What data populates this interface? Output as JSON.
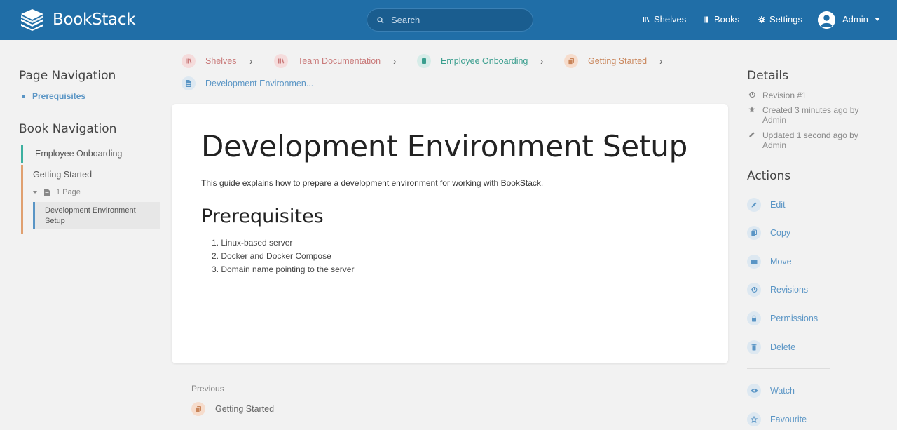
{
  "header": {
    "app_name": "BookStack",
    "search_placeholder": "Search",
    "nav": {
      "shelves": "Shelves",
      "books": "Books",
      "settings": "Settings"
    },
    "user": "Admin"
  },
  "breadcrumbs": [
    {
      "label": "Shelves",
      "color": "#c97a7a"
    },
    {
      "label": "Team Documentation",
      "color": "#c97a7a"
    },
    {
      "label": "Employee Onboarding",
      "color": "#3a9e8e"
    },
    {
      "label": "Getting Started",
      "color": "#c9855a"
    },
    {
      "label": "Development Environmen...",
      "color": "#5a95c5"
    }
  ],
  "page_nav": {
    "heading": "Page Navigation",
    "items": [
      "Prerequisites"
    ]
  },
  "book_nav": {
    "heading": "Book Navigation",
    "book": "Employee Onboarding",
    "chapter": "Getting Started",
    "pages_count": "1 Page",
    "current_page_line1": "Development Environment",
    "current_page_line2": "Setup"
  },
  "page": {
    "title": "Development Environment Setup",
    "intro": "This guide explains how to prepare a development environment for working with BookStack.",
    "section_heading": "Prerequisites",
    "list": [
      "1. Linux-based server",
      "2. Docker and Docker Compose",
      "3. Domain name pointing to the server"
    ]
  },
  "previous": {
    "label": "Previous",
    "link": "Getting Started"
  },
  "details": {
    "heading": "Details",
    "revision": "Revision #1",
    "created_line1": "Created 3 minutes ago by",
    "created_line2": "Admin",
    "updated_line1": "Updated 1 second ago by",
    "updated_line2": "Admin"
  },
  "actions": {
    "heading": "Actions",
    "edit": "Edit",
    "copy": "Copy",
    "move": "Move",
    "revisions": "Revisions",
    "permissions": "Permissions",
    "delete": "Delete",
    "watch": "Watch",
    "favourite": "Favourite"
  },
  "colors": {
    "header": "#206ea7",
    "link": "#5a95c5",
    "shelf": "#c97a7a",
    "book": "#3a9e8e",
    "chapter": "#c9855a"
  }
}
